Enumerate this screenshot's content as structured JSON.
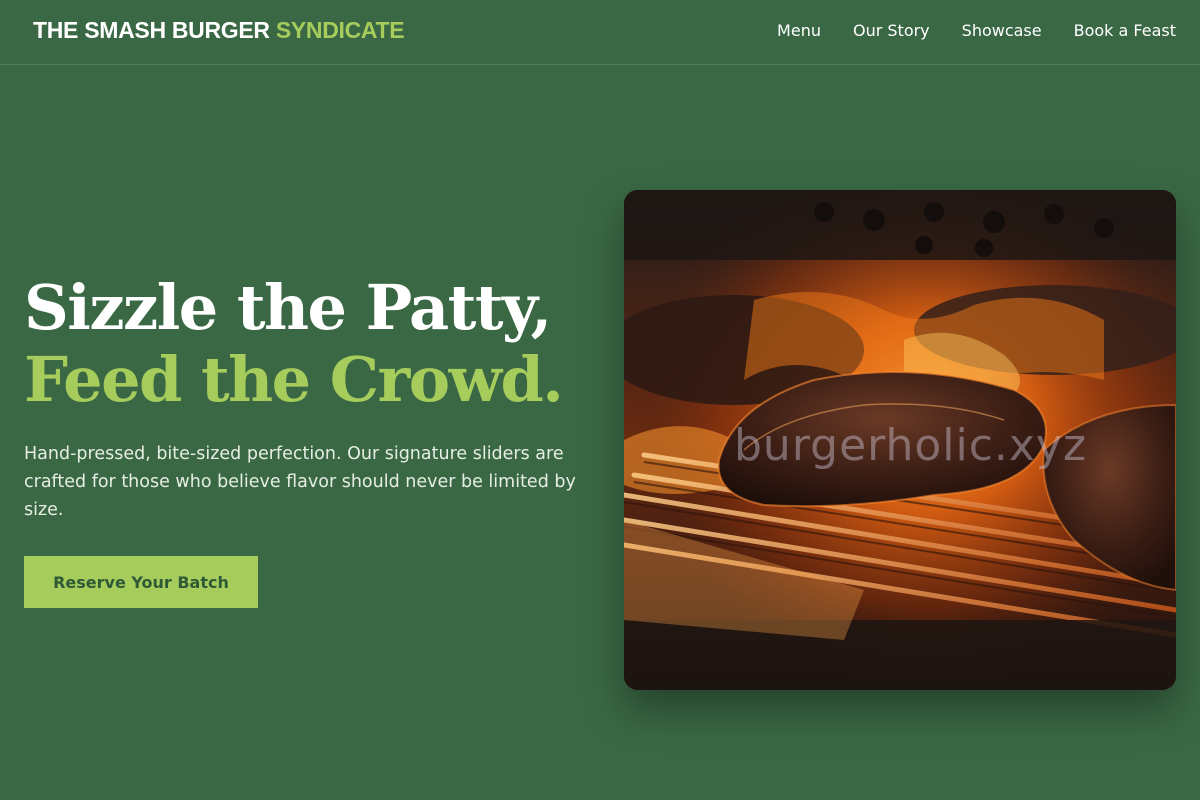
{
  "brand": {
    "name_main": "THE SMASH BURGER",
    "name_accent": "SYNDICATE"
  },
  "nav": {
    "items": [
      {
        "label": "Menu"
      },
      {
        "label": "Our Story"
      },
      {
        "label": "Showcase"
      },
      {
        "label": "Book a Feast"
      }
    ]
  },
  "hero": {
    "title_line1": "Sizzle the Patty,",
    "title_line2": "Feed the Crowd.",
    "description": "Hand-pressed, bite-sized perfection. Our signature sliders are crafted for those who believe flavor should never be limited by size.",
    "cta_label": "Reserve Your Batch",
    "image_watermark": "burgerholic.xyz"
  },
  "colors": {
    "background": "#3a6844",
    "accent": "#a6cc5c",
    "button_text": "#2f5a36",
    "text": "#ffffff"
  }
}
